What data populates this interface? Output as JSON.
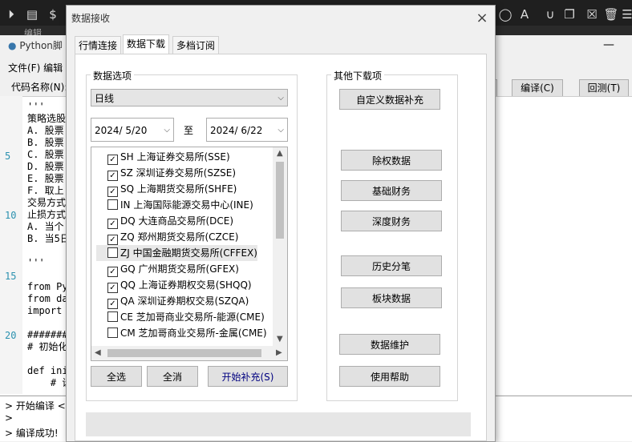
{
  "bg": {
    "window_title": "Python脚",
    "menu": "文件(F)   编辑",
    "menu2": "编辑",
    "code_name_label": "代码名称(N):",
    "compile_btn": "编译(C)",
    "back_btn": "回测(T)",
    "line_numbers": [
      "5",
      "10",
      "15",
      "20"
    ],
    "code_lines": [
      "'''",
      "策略选股",
      "A. 股票",
      "B. 股票",
      "C. 股票",
      "D. 股票",
      "E. 股票",
      "F. 取上",
      "交易方式",
      "止损方式",
      "A. 当个",
      "B. 当5日",
      "",
      "'''",
      "",
      "from Py",
      "from da",
      "import",
      "",
      "#######",
      "# 初始化",
      "",
      "def ini",
      "    # 设"
    ],
    "output_lines": [
      "> 开始编译 <",
      ">",
      "> 编译成功!"
    ]
  },
  "dialog": {
    "title": "数据接收",
    "close_glyph": "×",
    "tabs": [
      "行情连接",
      "数据下载",
      "多档订阅"
    ],
    "group_left": "数据选项",
    "group_right": "其他下载项",
    "period": "日线",
    "date_from": "2024/ 5/20",
    "date_sep": "至",
    "date_to": "2024/ 6/22",
    "exchanges": [
      {
        "label": "SH 上海证券交易所(SSE)",
        "checked": true
      },
      {
        "label": "SZ 深圳证券交易所(SZSE)",
        "checked": true
      },
      {
        "label": "SQ 上海期货交易所(SHFE)",
        "checked": true
      },
      {
        "label": "IN 上海国际能源交易中心(INE)",
        "checked": false
      },
      {
        "label": "DQ 大连商品交易所(DCE)",
        "checked": true
      },
      {
        "label": "ZQ 郑州期货交易所(CZCE)",
        "checked": true
      },
      {
        "label": "ZJ 中国金融期货交易所(CFFEX)",
        "checked": false
      },
      {
        "label": "GQ 广州期货交易所(GFEX)",
        "checked": true
      },
      {
        "label": "QQ 上海证券期权交易(SHQQ)",
        "checked": true
      },
      {
        "label": "QA 深圳证券期权交易(SZQA)",
        "checked": true
      },
      {
        "label": "CE 芝加哥商业交易所-能源(CME)",
        "checked": false
      },
      {
        "label": "CM 芝加哥商业交易所-金属(CME)",
        "checked": false
      }
    ],
    "select_all": "全选",
    "deselect_all": "全消",
    "start_fill": "开始补充(S)",
    "right_buttons": [
      "自定义数据补充",
      "除权数据",
      "基础财务",
      "深度财务",
      "历史分笔",
      "板块数据",
      "数据维护",
      "使用帮助"
    ]
  }
}
